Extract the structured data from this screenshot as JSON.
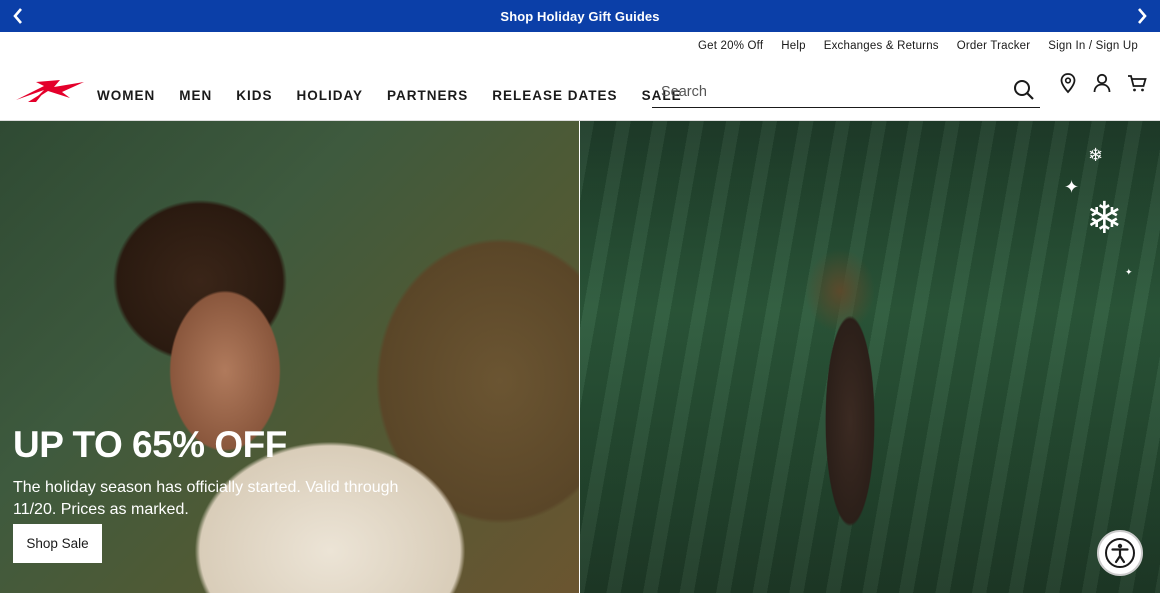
{
  "promo": {
    "text": "Shop Holiday Gift Guides"
  },
  "utility_links": [
    "Get 20% Off",
    "Help",
    "Exchanges & Returns",
    "Order Tracker",
    "Sign In / Sign Up"
  ],
  "nav": [
    "WOMEN",
    "MEN",
    "KIDS",
    "HOLIDAY",
    "PARTNERS",
    "RELEASE DATES",
    "SALE"
  ],
  "search": {
    "placeholder": "Search"
  },
  "hero": {
    "heading": "UP TO 65% OFF",
    "body": "The holiday season has officially started. Valid through 11/20. Prices as marked.",
    "cta": "Shop Sale"
  },
  "colors": {
    "promo_bg": "#0b3fa8",
    "brand_red": "#e4002b"
  },
  "icons": [
    "chevron-left-icon",
    "chevron-right-icon",
    "search-icon",
    "location-pin-icon",
    "account-icon",
    "cart-icon",
    "accessibility-icon"
  ]
}
